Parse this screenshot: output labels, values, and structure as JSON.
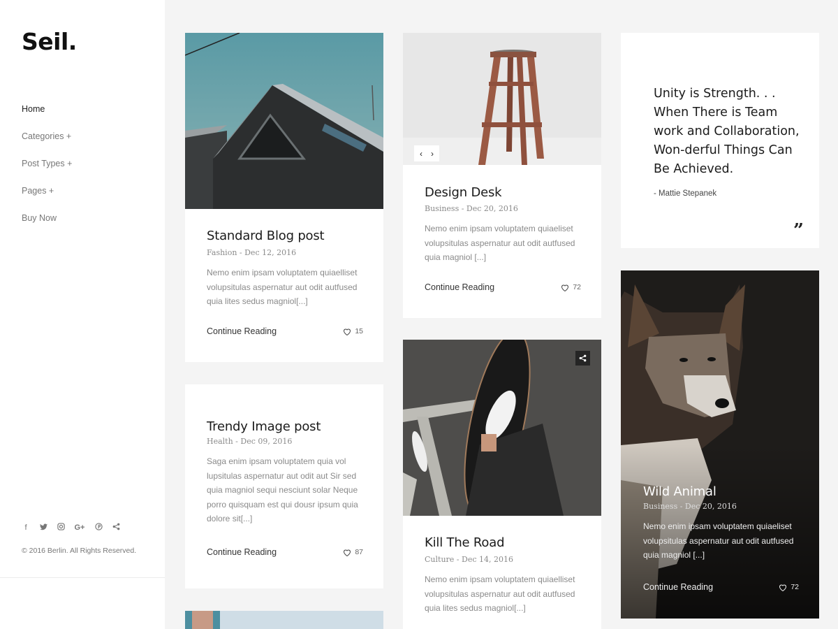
{
  "brand": {
    "logo": "Seil."
  },
  "nav": {
    "items": [
      {
        "label": "Home"
      },
      {
        "label": "Categories +"
      },
      {
        "label": "Post Types +"
      },
      {
        "label": "Pages +"
      },
      {
        "label": "Buy Now"
      }
    ]
  },
  "social": {
    "icons": [
      {
        "name": "facebook-icon",
        "glyph": "f"
      },
      {
        "name": "twitter-icon",
        "glyph": "🐦"
      },
      {
        "name": "instagram-icon",
        "glyph": "◎"
      },
      {
        "name": "google-plus-icon",
        "glyph": "G+"
      },
      {
        "name": "pinterest-icon",
        "glyph": "℗"
      },
      {
        "name": "share-icon",
        "glyph": "<"
      }
    ]
  },
  "footer": {
    "copyright": "© 2016 Berlin. All Rights Reserved."
  },
  "posts": {
    "standard": {
      "title": "Standard Blog post",
      "meta": "Fashion - Dec 12, 2016",
      "excerpt": "Nemo enim ipsam voluptatem quiaelliset volupsitulas aspernatur aut odit autfused quia lites sedus magniol[...]",
      "read_more": "Continue Reading",
      "likes": "15"
    },
    "trendy": {
      "title": "Trendy Image post",
      "meta": "Health - Dec 09, 2016",
      "excerpt": "Saga enim ipsam voluptatem quia vol lupsitulas aspernatur aut odit aut Sir sed quia magniol sequi nesciunt solar Neque porro quisquam est qui dousr ipsum quia dolore sit[...]",
      "read_more": "Continue Reading",
      "likes": "87"
    },
    "design": {
      "title": "Design Desk",
      "meta": "Business - Dec 20, 2016",
      "excerpt": "Nemo enim ipsam voluptatem quiaeliset volupsitulas aspernatur aut odit autfused quia magniol [...]",
      "read_more": "Continue Reading",
      "likes": "72"
    },
    "road": {
      "title": "Kill The Road",
      "meta": "Culture - Dec 14, 2016",
      "excerpt": "Nemo enim ipsam voluptatem quiaelliset volupsitulas aspernatur aut odit autfused quia lites sedus magniol[...]"
    },
    "quote": {
      "text": "Unity is Strength. . . When There is Team work and Collaboration, Won-derful Things Can Be Achieved.",
      "author": "- Mattie Stepanek",
      "mark": "”"
    },
    "wild": {
      "title": "Wild Animal",
      "meta": "Business - Dec 20, 2016",
      "excerpt": "Nemo enim ipsam voluptatem quiaeliset volupsitulas aspernatur aut odit autfused quia magniol [...]",
      "read_more": "Continue Reading",
      "likes": "72"
    }
  },
  "slider": {
    "prev": "‹",
    "next": "›"
  },
  "colors": {
    "page_bg": "#f4f4f4",
    "card_bg": "#ffffff",
    "text_dark": "#1b1b1b",
    "text_muted": "#8a8a8a"
  }
}
